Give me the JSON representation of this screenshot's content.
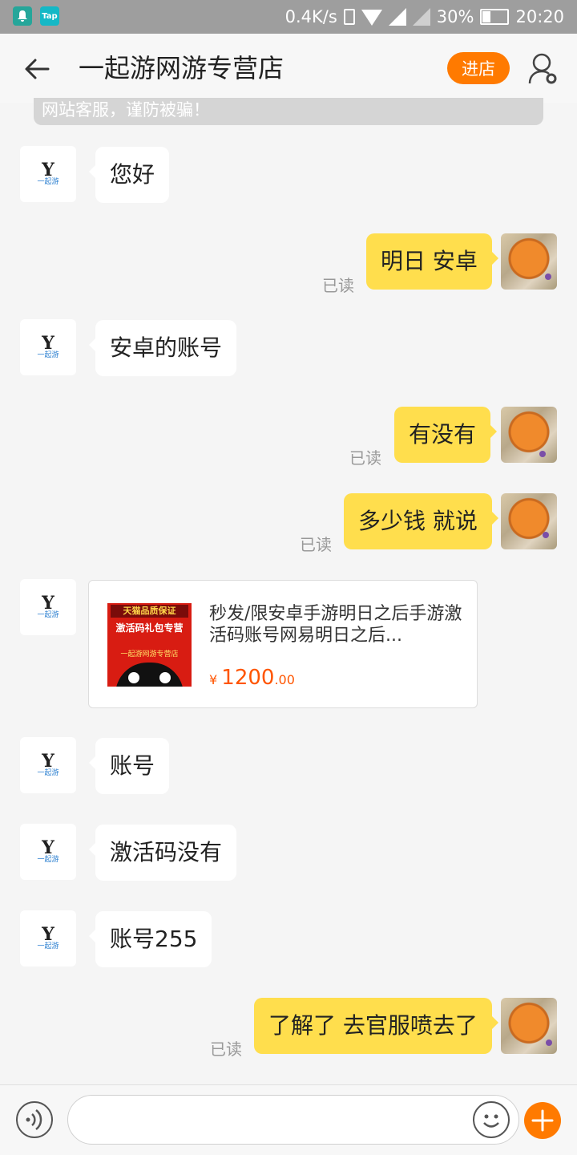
{
  "status_bar": {
    "apps": [
      "notification",
      "Tap"
    ],
    "network_speed": "0.4K/s",
    "battery": "30%",
    "time": "20:20"
  },
  "header": {
    "title": "一起游网游专营店",
    "enter_store": "进店"
  },
  "notice": {
    "text": "网站客服，谨防被骗！"
  },
  "shop_logo": {
    "mark": "Y",
    "sub": "一起游"
  },
  "messages": [
    {
      "from": "shop",
      "text": "您好"
    },
    {
      "from": "me",
      "text": "明日 安卓",
      "status": "已读"
    },
    {
      "from": "shop",
      "text": "安卓的账号"
    },
    {
      "from": "me",
      "text": "有没有",
      "status": "已读"
    },
    {
      "from": "me",
      "text": "多少钱 就说",
      "status": "已读"
    },
    {
      "from": "shop",
      "text": "账号"
    },
    {
      "from": "shop",
      "text": "激活码没有"
    },
    {
      "from": "shop",
      "text": "账号255"
    },
    {
      "from": "me",
      "text": "了解了 去官服喷去了",
      "status": "已读"
    }
  ],
  "product_card": {
    "image_text": {
      "banner": "天猫品质保证",
      "main": "激活码礼包专营",
      "shop": "一起游网游专营店"
    },
    "title": "秒发/限安卓手游明日之后手游激活码账号网易明日之后...",
    "currency": "¥",
    "price_int": "1200",
    "price_dec": ".00"
  },
  "colors": {
    "accent": "#ff7a00",
    "bubble_out": "#ffde4d",
    "price": "#ff5500"
  },
  "icons": [
    "back-arrow-icon",
    "user-settings-icon",
    "voice-icon",
    "emoji-icon",
    "plus-icon"
  ]
}
